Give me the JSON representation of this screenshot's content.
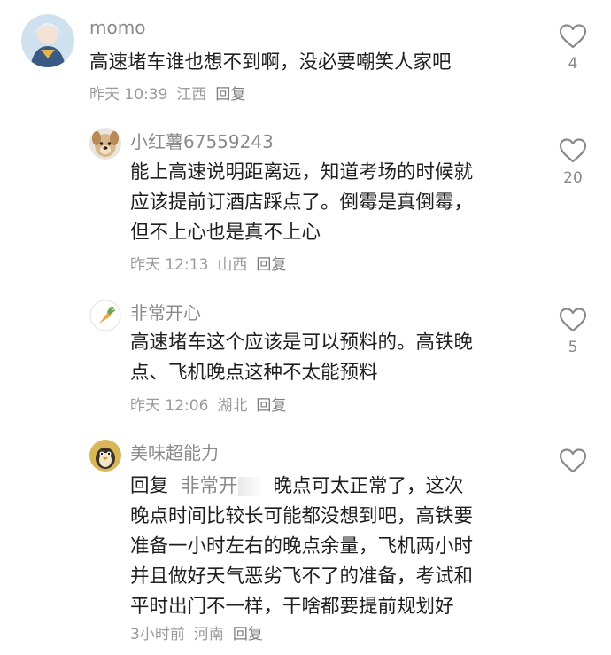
{
  "comments": [
    {
      "username": "momo",
      "avatar_icon": "anime-character-avatar-icon",
      "lines": [
        "高速堵车谁也想不到啊，没必要嘲笑人家吧"
      ],
      "time": "昨天 10:39",
      "location": "江西",
      "reply_label": "回复",
      "likes": "4"
    },
    {
      "username": "小红薯67559243",
      "avatar_icon": "puppy-avatar-icon",
      "lines": [
        "能上高速说明距离远，知道考场的时候就",
        "应该提前订酒店踩点了。倒霉是真倒霉，",
        "但不上心也是真不上心"
      ],
      "time": "昨天 12:13",
      "location": "山西",
      "reply_label": "回复",
      "likes": "20"
    },
    {
      "username": "非常开心",
      "avatar_icon": "carrot-avatar-icon",
      "lines": [
        "高速堵车这个应该是可以预料的。高铁晚",
        "点、飞机晚点这种不太能预料"
      ],
      "time": "昨天 12:06",
      "location": "湖北",
      "reply_label": "回复",
      "likes": "5"
    },
    {
      "username": "美味超能力",
      "avatar_icon": "cartoon-bird-avatar-icon",
      "reply_prefix": "回复",
      "mention": "非常开",
      "first_line_rest": "晚点可太正常了，这次",
      "lines": [
        "晚点时间比较长可能都没想到吧，高铁要",
        "准备一小时左右的晚点余量，飞机两小时",
        "并且做好天气恶劣飞不了的准备，考试和",
        "平时出门不一样，干啥都要提前规划好"
      ],
      "time": "3小时前",
      "location": "河南",
      "reply_label": "回复",
      "likes": ""
    }
  ],
  "colors": {
    "username": "#8a8a8a",
    "text": "#1f1f1f",
    "meta": "#9a9a9a",
    "heart_outline": "#8a8a8a"
  }
}
